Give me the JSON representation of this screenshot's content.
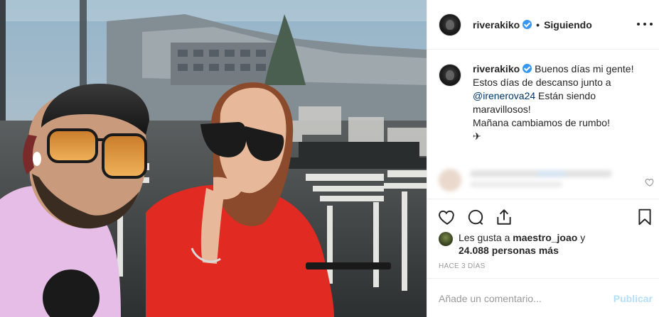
{
  "post": {
    "author": {
      "username": "riverakiko",
      "verified_icon": "verified-badge-icon",
      "follow_state": "Siguiendo",
      "separator": "•"
    },
    "caption": {
      "username": "riverakiko",
      "line1": "Buenos días mi gente!",
      "line2_before": "Estos días de descanso junto a",
      "mention": "@irenerova24",
      "line2_after": "Están siendo maravillosos!",
      "line3": "Mañana cambiamos de rumbo!",
      "emoji": "✈"
    },
    "likes": {
      "prefix": "Les gusta a",
      "user": "maestro_joao",
      "connector": "y",
      "count_text": "24.088 personas más"
    },
    "timestamp": "HACE 3 DÍAS",
    "comment_box": {
      "placeholder": "Añade un comentario...",
      "publish_label": "Publicar"
    }
  },
  "colors": {
    "accent_blue": "#3897f0",
    "mention_blue": "#003569",
    "publish_disabled": "#b2dffc",
    "text": "#262626",
    "muted": "#999999",
    "divider": "#efefef"
  },
  "icons": {
    "more": "more-options-icon",
    "like": "heart-icon",
    "comment": "comment-bubble-icon",
    "share": "share-icon",
    "save": "bookmark-icon",
    "comment_like": "small-heart-icon"
  }
}
